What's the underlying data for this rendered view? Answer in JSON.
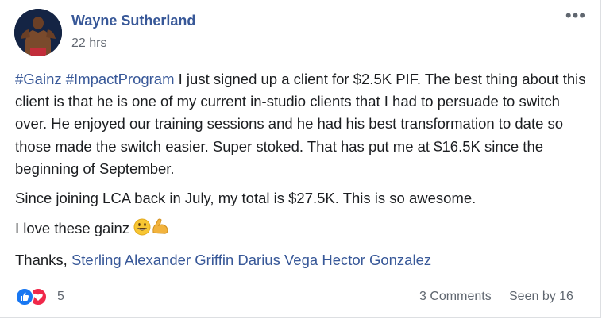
{
  "post": {
    "author": "Wayne Sutherland",
    "time": "22 hrs",
    "more_icon": "more-horizontal-icon",
    "hashtags": [
      "#Gainz",
      "#ImpactProgram"
    ],
    "paragraph1_text": " I just signed up a client for $2.5K PIF. The best thing about this client is that he is one of my current in-studio clients that I had to persuade to switch over. He enjoyed our training sessions and he had his best transformation to date so those made the switch easier. Super stoked. That has put me at $16.5K since the beginning of September.",
    "paragraph2": "Since joining LCA back in July, my total is $27.5K. This is so awesome.",
    "paragraph3": "I love these gainz ",
    "emojis": [
      "grinning-face-icon",
      "flexed-biceps-icon"
    ],
    "thanks_prefix": "Thanks, ",
    "mentions": [
      "Sterling Alexander Griffin",
      "Darius Vega",
      "Hector Gonzalez"
    ]
  },
  "footer": {
    "reactions": [
      "like-icon",
      "love-icon"
    ],
    "reaction_count": "5",
    "comments": "3 Comments",
    "seen": "Seen by 16"
  },
  "colors": {
    "link": "#385898",
    "text": "#1c1e21",
    "meta": "#616770",
    "like": "#1877f2",
    "love": "#f0284a"
  }
}
